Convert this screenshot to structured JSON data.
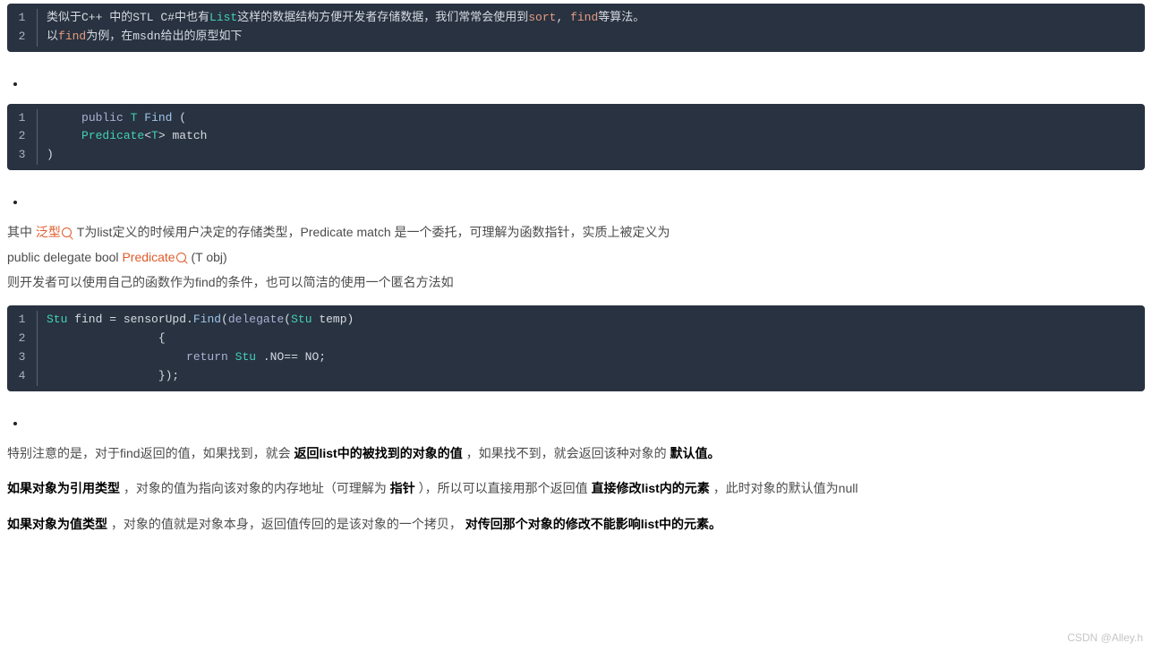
{
  "code1": {
    "lines": [
      [
        {
          "c": "cc-normal",
          "t": "类似于C++ 中的STL C#中也有"
        },
        {
          "c": "cc-type",
          "t": "List"
        },
        {
          "c": "cc-normal",
          "t": "这样的数据结构方便开发者存储数据，我们常常会使用到"
        },
        {
          "c": "cc-builtin",
          "t": "sort"
        },
        {
          "c": "cc-normal",
          "t": ", "
        },
        {
          "c": "cc-builtin",
          "t": "find"
        },
        {
          "c": "cc-normal",
          "t": "等算法。"
        }
      ],
      [
        {
          "c": "cc-normal",
          "t": "以"
        },
        {
          "c": "cc-builtin",
          "t": "find"
        },
        {
          "c": "cc-normal",
          "t": "为例，在msdn给出的原型如下"
        }
      ]
    ]
  },
  "code2": {
    "lines": [
      [
        {
          "c": "cc-normal",
          "t": "     "
        },
        {
          "c": "cc-keyword",
          "t": "public"
        },
        {
          "c": "cc-normal",
          "t": " "
        },
        {
          "c": "cc-type",
          "t": "T"
        },
        {
          "c": "cc-normal",
          "t": " "
        },
        {
          "c": "cc-func",
          "t": "Find"
        },
        {
          "c": "cc-normal",
          "t": " ("
        }
      ],
      [
        {
          "c": "cc-normal",
          "t": "     "
        },
        {
          "c": "cc-type",
          "t": "Predicate"
        },
        {
          "c": "cc-normal",
          "t": "<"
        },
        {
          "c": "cc-type",
          "t": "T"
        },
        {
          "c": "cc-normal",
          "t": "> match"
        }
      ],
      [
        {
          "c": "cc-normal",
          "t": ")"
        }
      ]
    ]
  },
  "para1": {
    "pre_link": "其中 ",
    "link1": "泛型",
    "mid1": " T为list定义的时候用户决定的存储类型，Predicate match 是一个委托，可理解为函数指针，实质上被定义为",
    "line2_pre": "public delegate bool  ",
    "link2": "Predicate",
    "line2_post": " (T obj)",
    "line3": "则开发者可以使用自己的函数作为find的条件，也可以简洁的使用一个匿名方法如"
  },
  "code3": {
    "lines": [
      [
        {
          "c": "cc-type",
          "t": "Stu"
        },
        {
          "c": "cc-normal",
          "t": " find = sensorUpd."
        },
        {
          "c": "cc-func",
          "t": "Find"
        },
        {
          "c": "cc-normal",
          "t": "("
        },
        {
          "c": "cc-keyword",
          "t": "delegate"
        },
        {
          "c": "cc-normal",
          "t": "("
        },
        {
          "c": "cc-type",
          "t": "Stu"
        },
        {
          "c": "cc-normal",
          "t": " temp)"
        }
      ],
      [
        {
          "c": "cc-normal",
          "t": "                {"
        }
      ],
      [
        {
          "c": "cc-normal",
          "t": "                    "
        },
        {
          "c": "cc-keyword",
          "t": "return"
        },
        {
          "c": "cc-normal",
          "t": " "
        },
        {
          "c": "cc-type",
          "t": "Stu"
        },
        {
          "c": "cc-normal",
          "t": " .NO== NO;"
        }
      ],
      [
        {
          "c": "cc-normal",
          "t": "                });"
        }
      ]
    ]
  },
  "para2": {
    "p1_pre": "特别注意的是，对于find返回的值，如果找到，就会",
    "p1_b1": "返回list中的被找到的对象的值",
    "p1_mid": "，如果找不到，就会返回该种对象的",
    "p1_b2": "默认值。",
    "p2_b1": "如果对象为引用类型",
    "p2_mid": "，对象的值为指向该对象的内存地址（可理解为",
    "p2_b2": "指针",
    "p2_mid2": "），所以可以直接用那个返回值",
    "p2_b3": "直接修改list内的元素",
    "p2_post": "，此时对象的默认值为null",
    "p3_b1": "如果对象为值类型 ",
    "p3_mid": "，对象的值就是对象本身，返回值传回的是该对象的一个拷贝，",
    "p3_b2": "对传回那个对象的修改不能影响list中的元素。"
  },
  "watermark": "CSDN @Alley.h"
}
